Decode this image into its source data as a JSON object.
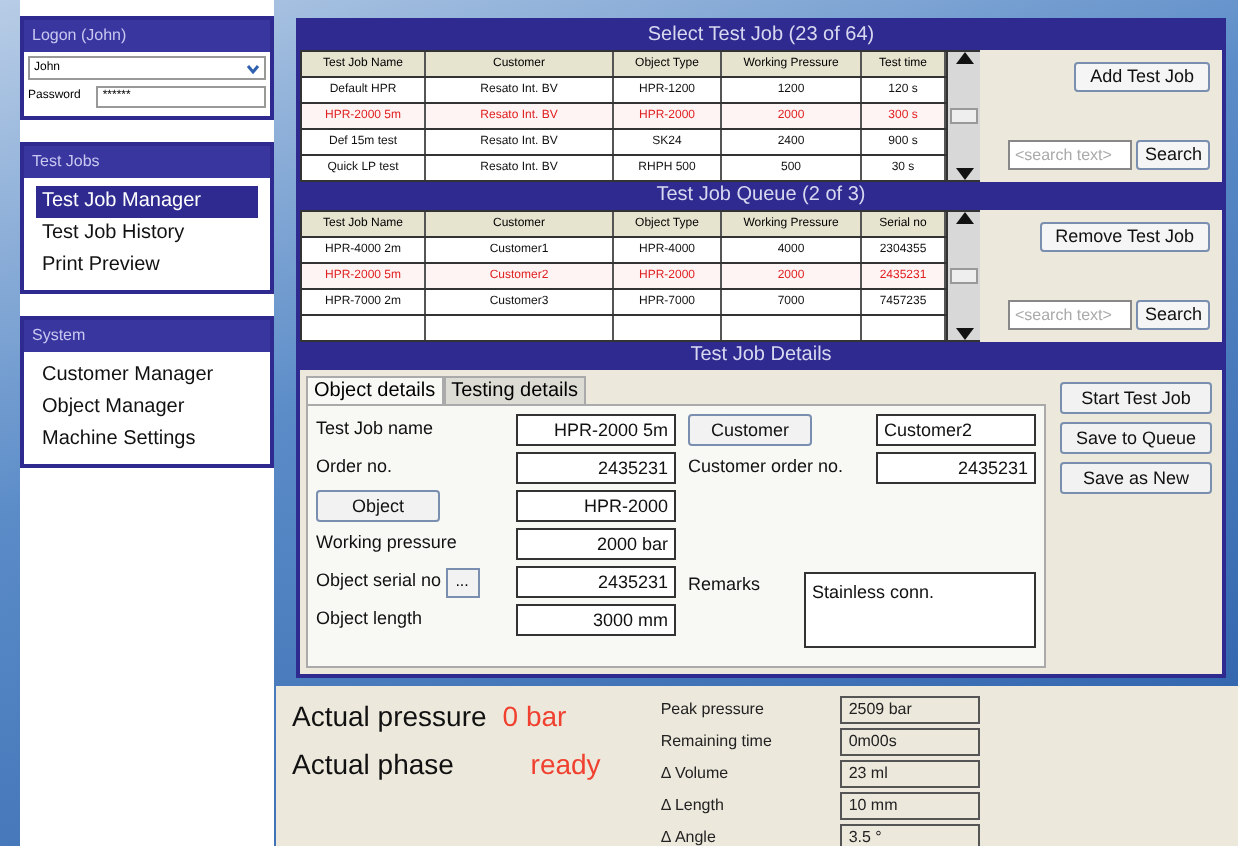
{
  "sidebar": {
    "logon": {
      "title": "Logon (John)",
      "user": "John",
      "password_label": "Password",
      "password": "******"
    },
    "groups": [
      {
        "title": "Test Jobs",
        "items": [
          {
            "label": "Test Job Manager",
            "selected": true
          },
          {
            "label": "Test Job History",
            "selected": false
          },
          {
            "label": "Print Preview",
            "selected": false
          }
        ]
      },
      {
        "title": "System",
        "items": [
          {
            "label": "Customer Manager",
            "selected": false
          },
          {
            "label": "Object Manager",
            "selected": false
          },
          {
            "label": "Machine Settings",
            "selected": false
          }
        ]
      }
    ]
  },
  "select_jobs": {
    "title": "Select Test Job (23 of 64)",
    "columns": [
      "Test Job Name",
      "Customer",
      "Object Type",
      "Working Pressure",
      "Test time"
    ],
    "rows": [
      {
        "cells": [
          "Default HPR",
          "Resato Int. BV",
          "HPR-1200",
          "1200",
          "120 s"
        ],
        "selected": false
      },
      {
        "cells": [
          "HPR-2000 5m",
          "Resato Int. BV",
          "HPR-2000",
          "2000",
          "300 s"
        ],
        "selected": true
      },
      {
        "cells": [
          "Def 15m test",
          "Resato Int. BV",
          "SK24",
          "2400",
          "900 s"
        ],
        "selected": false
      },
      {
        "cells": [
          "Quick LP test",
          "Resato Int. BV",
          "RHPH 500",
          "500",
          "30 s"
        ],
        "selected": false
      }
    ],
    "action": "Add Test Job",
    "search_placeholder": "<search text>",
    "search_button": "Search"
  },
  "queue": {
    "title": "Test Job Queue (2 of 3)",
    "columns": [
      "Test Job Name",
      "Customer",
      "Object Type",
      "Working Pressure",
      "Serial no"
    ],
    "rows": [
      {
        "cells": [
          "HPR-4000 2m",
          "Customer1",
          "HPR-4000",
          "4000",
          "2304355"
        ],
        "selected": false
      },
      {
        "cells": [
          "HPR-2000 5m",
          "Customer2",
          "HPR-2000",
          "2000",
          "2435231"
        ],
        "selected": true
      },
      {
        "cells": [
          "HPR-7000 2m",
          "Customer3",
          "HPR-7000",
          "7000",
          "7457235"
        ],
        "selected": false
      }
    ],
    "action": "Remove Test Job",
    "search_placeholder": "<search text>",
    "search_button": "Search"
  },
  "details": {
    "title": "Test Job Details",
    "tabs": [
      {
        "label": "Object details",
        "selected": true
      },
      {
        "label": "Testing details",
        "selected": false
      }
    ],
    "test_job_name": {
      "label": "Test Job name",
      "value": "HPR-2000 5m"
    },
    "order_no": {
      "label": "Order no.",
      "value": "2435231"
    },
    "object": {
      "button": "Object",
      "value": "HPR-2000"
    },
    "working_pressure": {
      "label": "Working pressure",
      "value": "2000 bar"
    },
    "object_serial": {
      "label": "Object serial no",
      "button": "...",
      "value": "2435231"
    },
    "object_length": {
      "label": "Object length",
      "value": "3000 mm"
    },
    "customer": {
      "button": "Customer",
      "value": "Customer2"
    },
    "customer_order": {
      "label": "Customer order no.",
      "value": "2435231"
    },
    "remarks": {
      "label": "Remarks",
      "value": "Stainless conn."
    },
    "actions": [
      "Start Test Job",
      "Save to Queue",
      "Save as New"
    ]
  },
  "status": {
    "actual_pressure": {
      "label": "Actual pressure",
      "value": "0 bar"
    },
    "actual_phase": {
      "label": "Actual phase",
      "value": "ready"
    },
    "readings": [
      {
        "label": "Peak pressure",
        "value": "2509 bar"
      },
      {
        "label": "Remaining time",
        "value": "0m00s"
      },
      {
        "label": "Δ Volume",
        "value": "23 ml"
      },
      {
        "label": "Δ Length",
        "value": "10 mm"
      },
      {
        "label": "Δ Angle",
        "value": "3.5 °"
      }
    ]
  }
}
